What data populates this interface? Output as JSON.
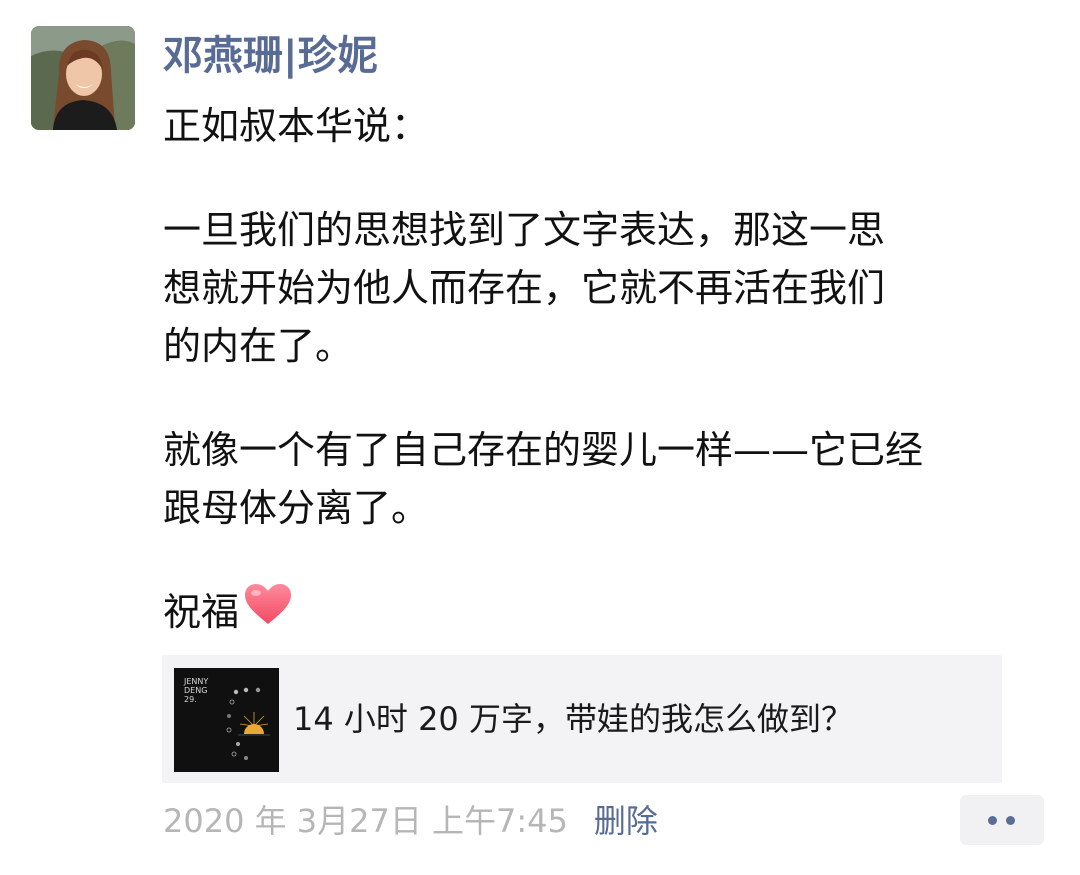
{
  "post": {
    "author": "邓燕珊|珍妮",
    "lines": [
      "正如叔本华说：",
      "",
      "一旦我们的思想找到了文字表达，那这一思",
      "想就开始为他人而存在，它就不再活在我们",
      "的内在了。",
      "",
      "就像一个有了自己存在的婴儿一样——它已经",
      "跟母体分离了。",
      "",
      "祝福"
    ],
    "emoji": "heart-emoji"
  },
  "shared_link": {
    "title": "14 小时 20 万字，带娃的我怎么做到？",
    "thumb_lines": [
      "JENNY",
      "DENG",
      "29."
    ]
  },
  "footer": {
    "timestamp": "2020 年 3月27日 上午7:45",
    "delete_label": "删除",
    "more_icon": "more-dots-icon"
  },
  "colors": {
    "link_blue": "#576b95",
    "text": "#111111",
    "meta_gray": "#b6b6b6",
    "card_bg": "#f3f3f5"
  }
}
